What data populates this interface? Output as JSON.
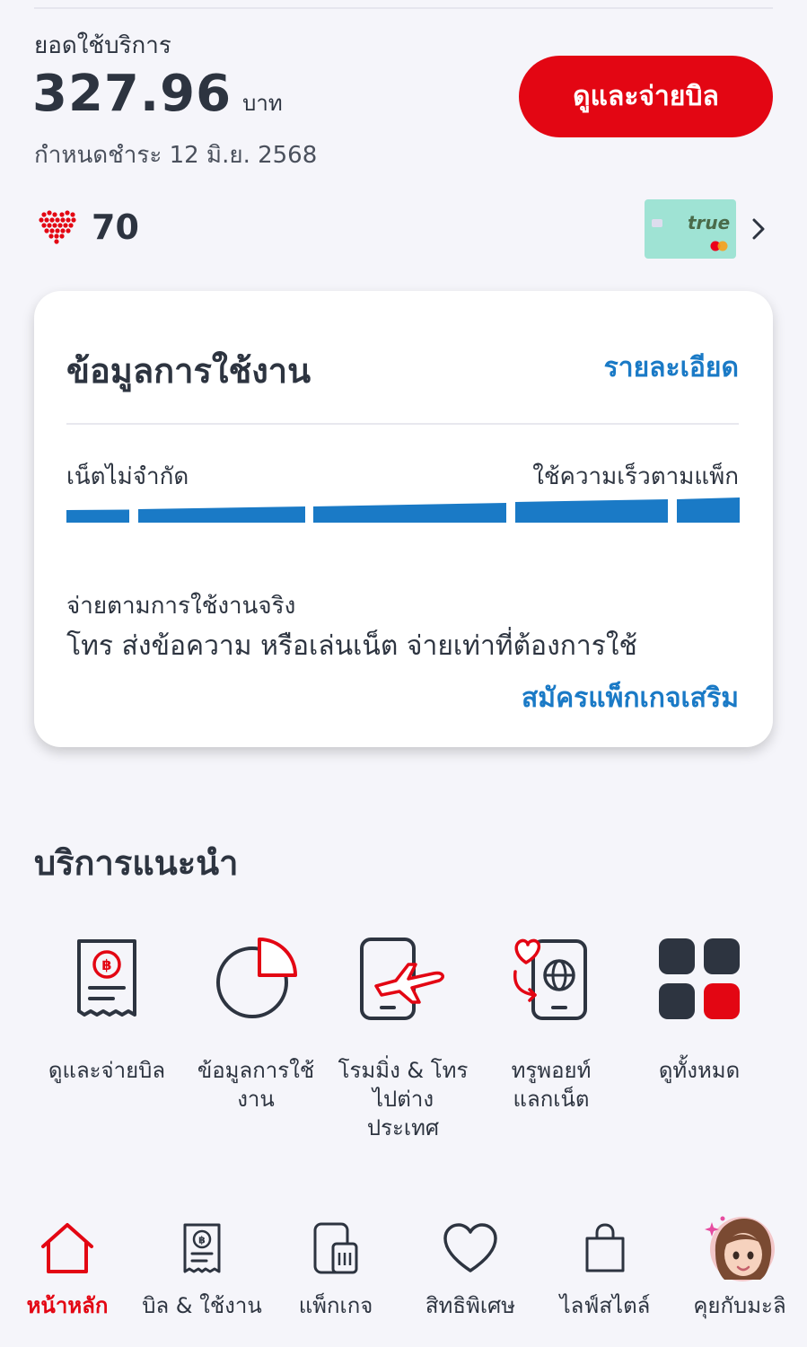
{
  "bill": {
    "label": "ยอดใช้บริการ",
    "amount": "327.96",
    "unit": "บาท",
    "due": "กำหนดชำระ 12 มิ.ย. 2568",
    "pay_button": "ดูและจ่ายบิล"
  },
  "points": {
    "value": "70"
  },
  "card": {
    "brand": "true"
  },
  "usage": {
    "title": "ข้อมูลการใช้งาน",
    "detail_link": "รายละเอียด",
    "net_label": "เน็ตไม่จำกัด",
    "net_speed": "ใช้ความเร็วตามแพ็ก",
    "plan_label": "จ่ายตามการใช้งานจริง",
    "plan_desc": "โทร ส่งข้อความ หรือเล่นเน็ต จ่ายเท่าที่ต้องการใช้",
    "addon_link": "สมัครแพ็กเกจเสริม"
  },
  "recommended": {
    "title": "บริการแนะนำ",
    "items": [
      {
        "label_line1": "ดูและจ่ายบิล",
        "label_line2": "",
        "label_line3": "",
        "icon": "bill-icon"
      },
      {
        "label_line1": "ข้อมูลการใช้",
        "label_line2": "งาน",
        "label_line3": "",
        "icon": "pie-chart-icon"
      },
      {
        "label_line1": "โรมมิ่ง & โทร",
        "label_line2": "ไปต่าง",
        "label_line3": "ประเทศ",
        "icon": "roaming-icon"
      },
      {
        "label_line1": "ทรูพอยท์",
        "label_line2": "แลกเน็ต",
        "label_line3": "",
        "icon": "points-exchange-icon"
      },
      {
        "label_line1": "ดูทั้งหมด",
        "label_line2": "",
        "label_line3": "",
        "icon": "grid-icon"
      }
    ]
  },
  "nav": {
    "items": [
      {
        "label": "หน้าหลัก",
        "icon": "home-icon"
      },
      {
        "label": "บิล & ใช้งาน",
        "icon": "bill-icon"
      },
      {
        "label": "แพ็กเกจ",
        "icon": "sim-icon"
      },
      {
        "label": "สิทธิพิเศษ",
        "icon": "heart-icon"
      },
      {
        "label": "ไลฟ์สไตล์",
        "icon": "shopping-bag-icon"
      },
      {
        "label": "คุยกับมะลิ",
        "icon": "avatar-icon"
      }
    ]
  },
  "colors": {
    "brand_red": "#e30613",
    "accent_blue": "#1a7ac6",
    "text_dark": "#2d3440",
    "background": "#f5f5fa"
  }
}
